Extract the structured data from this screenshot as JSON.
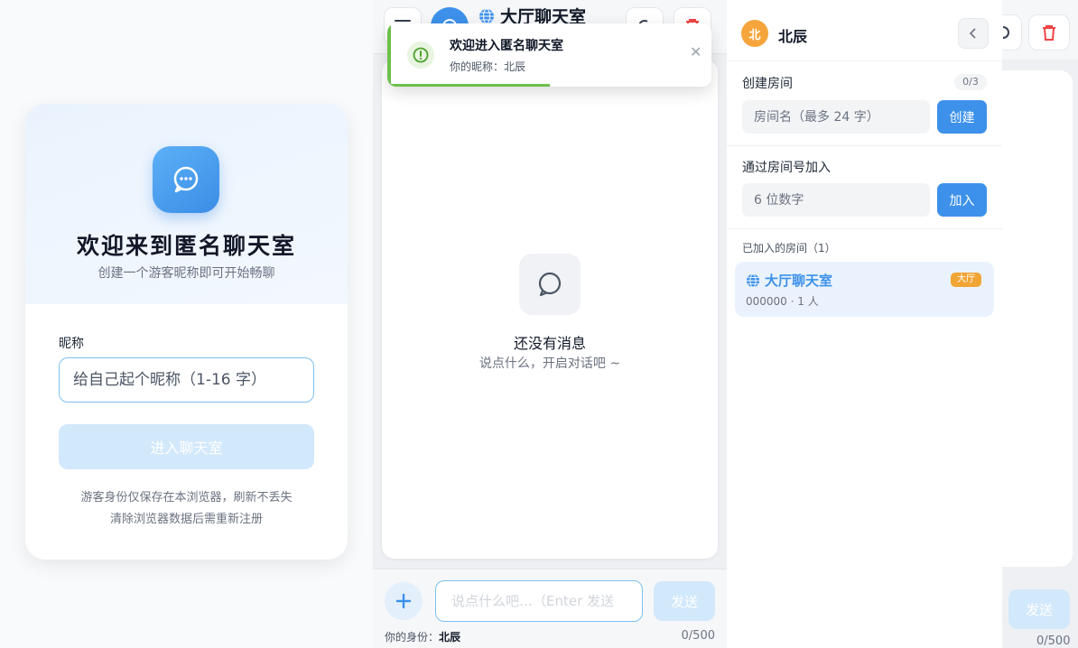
{
  "login": {
    "title": "欢迎来到匿名聊天室",
    "subtitle": "创建一个游客昵称即可开始畅聊",
    "nickname_label": "昵称",
    "nickname_placeholder": "给自己起个昵称（1-16 字）",
    "enter_button": "进入聊天室",
    "note_line1": "游客身份仅保存在本浏览器，刷新不丢失",
    "note_line2": "清除浏览器数据后需重新注册"
  },
  "chat": {
    "room_title": "大厅聊天室",
    "empty_title": "还没有消息",
    "empty_subtitle": "说点什么，开启对话吧 ~",
    "input_placeholder": "说点什么吧…（Enter 发送",
    "send_button": "发送",
    "identity_label": "你的身份：",
    "identity_name": "北辰",
    "char_count": "0/500"
  },
  "toast": {
    "title": "欢迎进入匿名聊天室",
    "message": "你的昵称：北辰",
    "progress": 0.5,
    "accent_color": "#6cc04a"
  },
  "drawer": {
    "avatar_text": "北",
    "user_name": "北辰",
    "create_label": "创建房间",
    "room_count": "0/3",
    "room_name_placeholder": "房间名（最多 24 字）",
    "create_button": "创建",
    "join_label": "通过房间号加入",
    "room_code_placeholder": "6 位数字",
    "join_button": "加入",
    "joined_label": "已加入的房间（1）",
    "rooms": [
      {
        "name": "大厅聊天室",
        "code": "000000",
        "members": "1 人",
        "badge": "大厅"
      }
    ]
  },
  "background": {
    "send_button": "发送",
    "char_count": "0/500"
  },
  "colors": {
    "brand": "#3d91ea",
    "badge": "#f0a535",
    "disabled_button": "#d2e8fb"
  }
}
